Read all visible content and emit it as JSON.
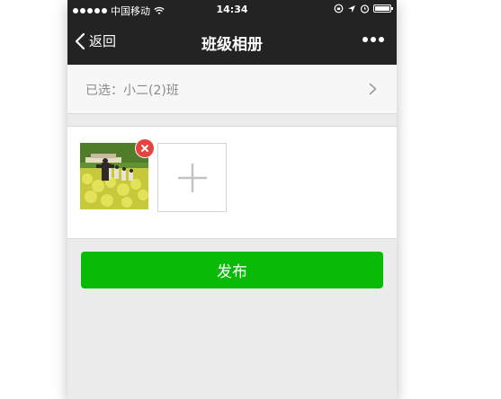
{
  "status_bar": {
    "carrier": "中国移动",
    "time": "14:34",
    "signal_icon": "signal-dots-icon",
    "wifi_icon": "wifi-icon",
    "battery_icon": "battery-icon"
  },
  "nav": {
    "back_label": "返回",
    "title": "班级相册",
    "more_icon": "more-icon"
  },
  "class_select": {
    "label": "已选：小二(2)班",
    "chevron_icon": "chevron-right-icon"
  },
  "photos": {
    "items": [
      {
        "kind": "photo",
        "remove_icon": "remove-icon"
      }
    ],
    "add_icon": "plus-icon"
  },
  "publish": {
    "label": "发布"
  },
  "colors": {
    "nav_bg": "#232323",
    "accent_green": "#09bb07",
    "remove_red": "#e64340",
    "page_bg": "#ebebeb"
  }
}
